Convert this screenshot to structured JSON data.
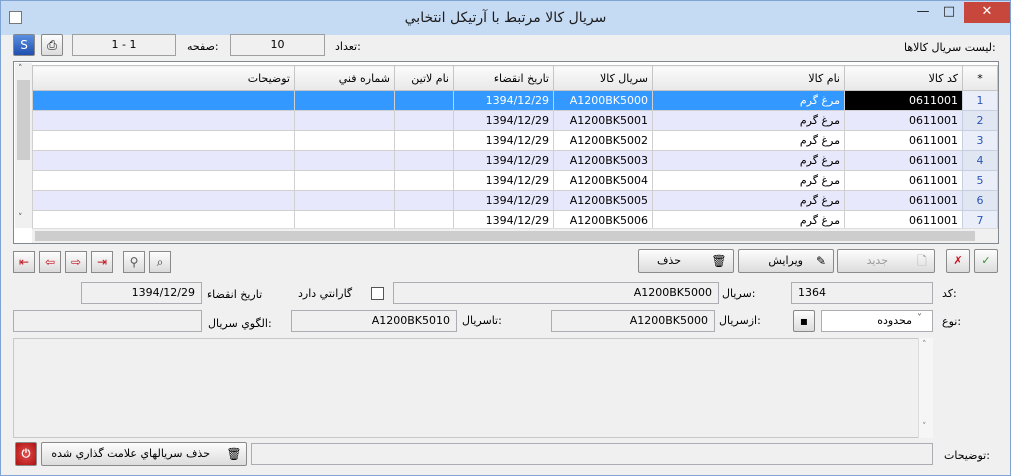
{
  "window": {
    "title": "سريال كالا مرتبط با آرتيكل انتخابي",
    "close_glyph": "✕",
    "max_glyph": "□",
    "min_glyph": "—"
  },
  "toolbar": {
    "list_label": "ليست سريال كالاها:",
    "count_label": "تعداد:",
    "count_value": "10",
    "page_label": "صفحه:",
    "page_value": "1 - 1"
  },
  "grid": {
    "columns": [
      "*",
      "كد كالا",
      "نام كالا",
      "سريال كالا",
      "تاريخ انقضاء",
      "نام لاتين",
      "شماره فني",
      "توضيحات"
    ],
    "rows": [
      {
        "num": "1",
        "code": "0611001",
        "name": "مرغ گرم",
        "serial": "A1200BK5000",
        "expiry": "1394/12/29",
        "latin": "",
        "tech": "",
        "desc": ""
      },
      {
        "num": "2",
        "code": "0611001",
        "name": "مرغ گرم",
        "serial": "A1200BK5001",
        "expiry": "1394/12/29",
        "latin": "",
        "tech": "",
        "desc": ""
      },
      {
        "num": "3",
        "code": "0611001",
        "name": "مرغ گرم",
        "serial": "A1200BK5002",
        "expiry": "1394/12/29",
        "latin": "",
        "tech": "",
        "desc": ""
      },
      {
        "num": "4",
        "code": "0611001",
        "name": "مرغ گرم",
        "serial": "A1200BK5003",
        "expiry": "1394/12/29",
        "latin": "",
        "tech": "",
        "desc": ""
      },
      {
        "num": "5",
        "code": "0611001",
        "name": "مرغ گرم",
        "serial": "A1200BK5004",
        "expiry": "1394/12/29",
        "latin": "",
        "tech": "",
        "desc": ""
      },
      {
        "num": "6",
        "code": "0611001",
        "name": "مرغ گرم",
        "serial": "A1200BK5005",
        "expiry": "1394/12/29",
        "latin": "",
        "tech": "",
        "desc": ""
      },
      {
        "num": "7",
        "code": "0611001",
        "name": "مرغ گرم",
        "serial": "A1200BK5006",
        "expiry": "1394/12/29",
        "latin": "",
        "tech": "",
        "desc": ""
      }
    ]
  },
  "actions": {
    "delete_label": "حذف",
    "edit_label": "ويرايش",
    "new_label": "جديد",
    "delete_marked_label": "حذف سريالهاي علامت گذاري شده"
  },
  "form": {
    "code_label": "كد:",
    "code_value": "1364",
    "serial_label": "سريال:",
    "serial_value": "A1200BK5000",
    "warranty_label": "گارانتي دارد",
    "expiry_label": "تاريخ انقضاء",
    "expiry_value": "1394/12/29",
    "type_label": "نوع:",
    "type_value": "محدوده",
    "from_serial_label": "ازسريال:",
    "from_serial_value": "A1200BK5000",
    "to_serial_label": "تاسريال:",
    "to_serial_value": "A1200BK5010",
    "pattern_label": "الگوي سريال:",
    "pattern_value": "",
    "notes_label": "توضيحات:"
  },
  "icons": {
    "help": "help-globe-icon",
    "print": "printer-icon",
    "nav": [
      "first-record-icon",
      "prev-record-icon",
      "next-record-icon",
      "last-record-icon",
      "filter-icon",
      "find-icon"
    ]
  },
  "colors": {
    "titlebar": "#c5daf3",
    "selection": "#3398ff",
    "close": "#c7473d"
  }
}
